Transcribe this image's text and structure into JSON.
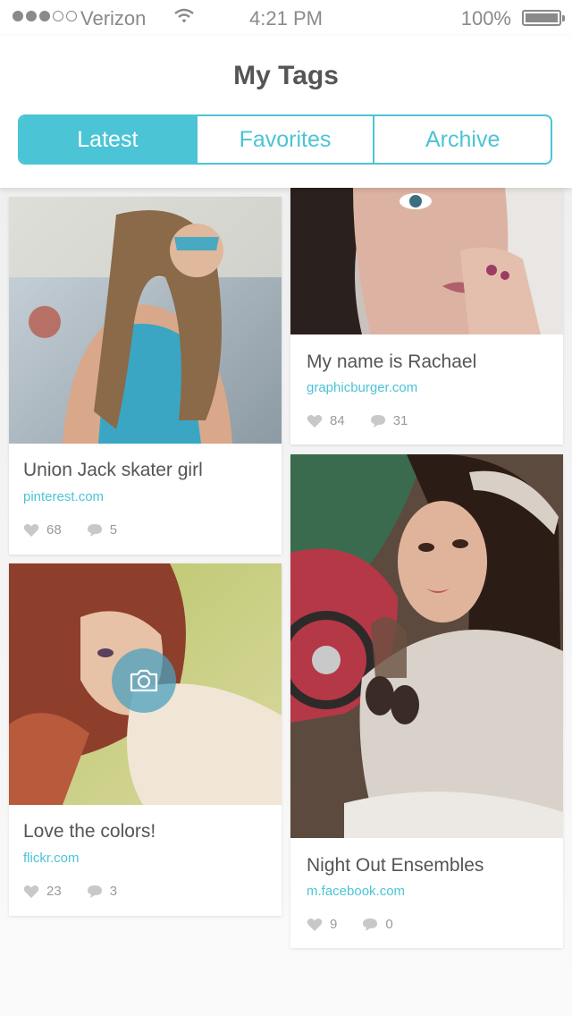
{
  "status_bar": {
    "carrier": "Verizon",
    "time": "4:21 PM",
    "battery": "100%"
  },
  "header": {
    "title": "My Tags",
    "tabs": [
      {
        "label": "Latest",
        "active": true
      },
      {
        "label": "Favorites",
        "active": false
      },
      {
        "label": "Archive",
        "active": false
      }
    ]
  },
  "colors": {
    "accent": "#4bc4d6",
    "text": "#555555",
    "muted": "#9a9a9a"
  },
  "cards": [
    {
      "title": "Union Jack skater girl",
      "source": "pinterest.com",
      "likes": "68",
      "comments": "5"
    },
    {
      "title": "My name is Rachael",
      "source": "graphicburger.com",
      "likes": "84",
      "comments": "31"
    },
    {
      "title": "Love the colors!",
      "source": "flickr.com",
      "likes": "23",
      "comments": "3"
    },
    {
      "title": "Night Out Ensembles",
      "source": "m.facebook.com",
      "likes": "9",
      "comments": "0"
    }
  ],
  "icons": {
    "like": "heart-icon",
    "comment": "speech-bubble-icon",
    "camera": "camera-icon"
  }
}
